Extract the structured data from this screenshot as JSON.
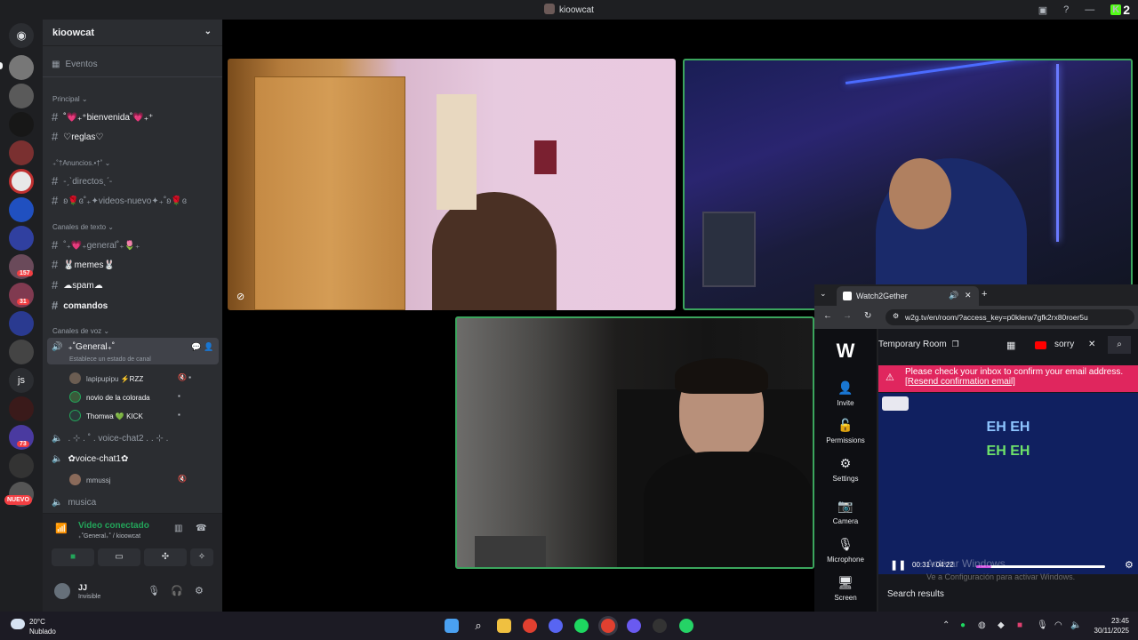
{
  "window": {
    "title": "kioowcat",
    "kick_badge": "K",
    "kick_count": "2"
  },
  "server": {
    "name": "kioowcat",
    "events_label": "Eventos",
    "categories": {
      "principal": "Principal",
      "anuncios": "₊˚†Anuncios.•†˚",
      "texto": "Canales de texto",
      "voz": "Canales de voz"
    },
    "channels": {
      "bienvenida": "˚💗₊⁺bienvenida˚💗₊⁺",
      "reglas": "♡reglas♡",
      "directos": "-ˏˋdirectosˎˊ-",
      "videos": "ʚ🌹ɞ˚₊✦videos-nuevo✦₊˚ʚ🌹ɞ",
      "general": "˚₊💗₊general˚₊🌷₊",
      "memes": "🐰memes🐰",
      "spam": "☁spam☁",
      "comandos": "comandos"
    },
    "voice": {
      "general": "₊˚General₊˚",
      "general_status": "Establece un estado de canal",
      "users": [
        {
          "name": "lapipupipu",
          "tag": "⚡RZZ"
        },
        {
          "name": "novio de la colorada",
          "tag": ""
        },
        {
          "name": "Thomwa",
          "tag": "💚 KICK"
        }
      ],
      "voice_chat2": ". ⊹ . ˚ . voice-chat2 . . ⊹ .",
      "voice_chat1": "✿voice-chat1✿",
      "voice_chat1_user": "mmussj",
      "musica": "musica"
    }
  },
  "voice_connection": {
    "title": "Video conectado",
    "subtitle": "₊˚General₊˚ / kioowcat"
  },
  "user": {
    "name": "JJ",
    "status": "Invisible"
  },
  "guild_badges": {
    "b1": "157",
    "b2": "31",
    "b3": "73",
    "nuevo": "NUEVO",
    "js": "js"
  },
  "w2g": {
    "tab_title": "Watch2Gether",
    "url": "w2g.tv/en/room/?access_key=p0klerw7gfk2rx80roer5u",
    "room_name": "Temporary Room",
    "search_query": "sorry",
    "sidebar": [
      "Invite",
      "Permissions",
      "Settings",
      "Camera",
      "Microphone",
      "Screen"
    ],
    "alert_text": "Please check your inbox to confirm your email address.",
    "alert_link": "[Resend confirmation email]",
    "lyrics_line1": "EH EH",
    "lyrics_line2": "EH EH",
    "time": "00:31 / 04:22",
    "progress": 0.12,
    "search_results_label": "Search results",
    "watermark_title": "Activar Windows",
    "watermark_sub": "Ve a Configuración para activar Windows."
  },
  "taskbar": {
    "temperature": "20°C",
    "weather": "Nublado",
    "time": "23:45",
    "date": "30/11/2025"
  },
  "colors": {
    "discord_green": "#23a55a",
    "alert_pink": "#e0265e",
    "speaking_border": "#3ba55d"
  }
}
